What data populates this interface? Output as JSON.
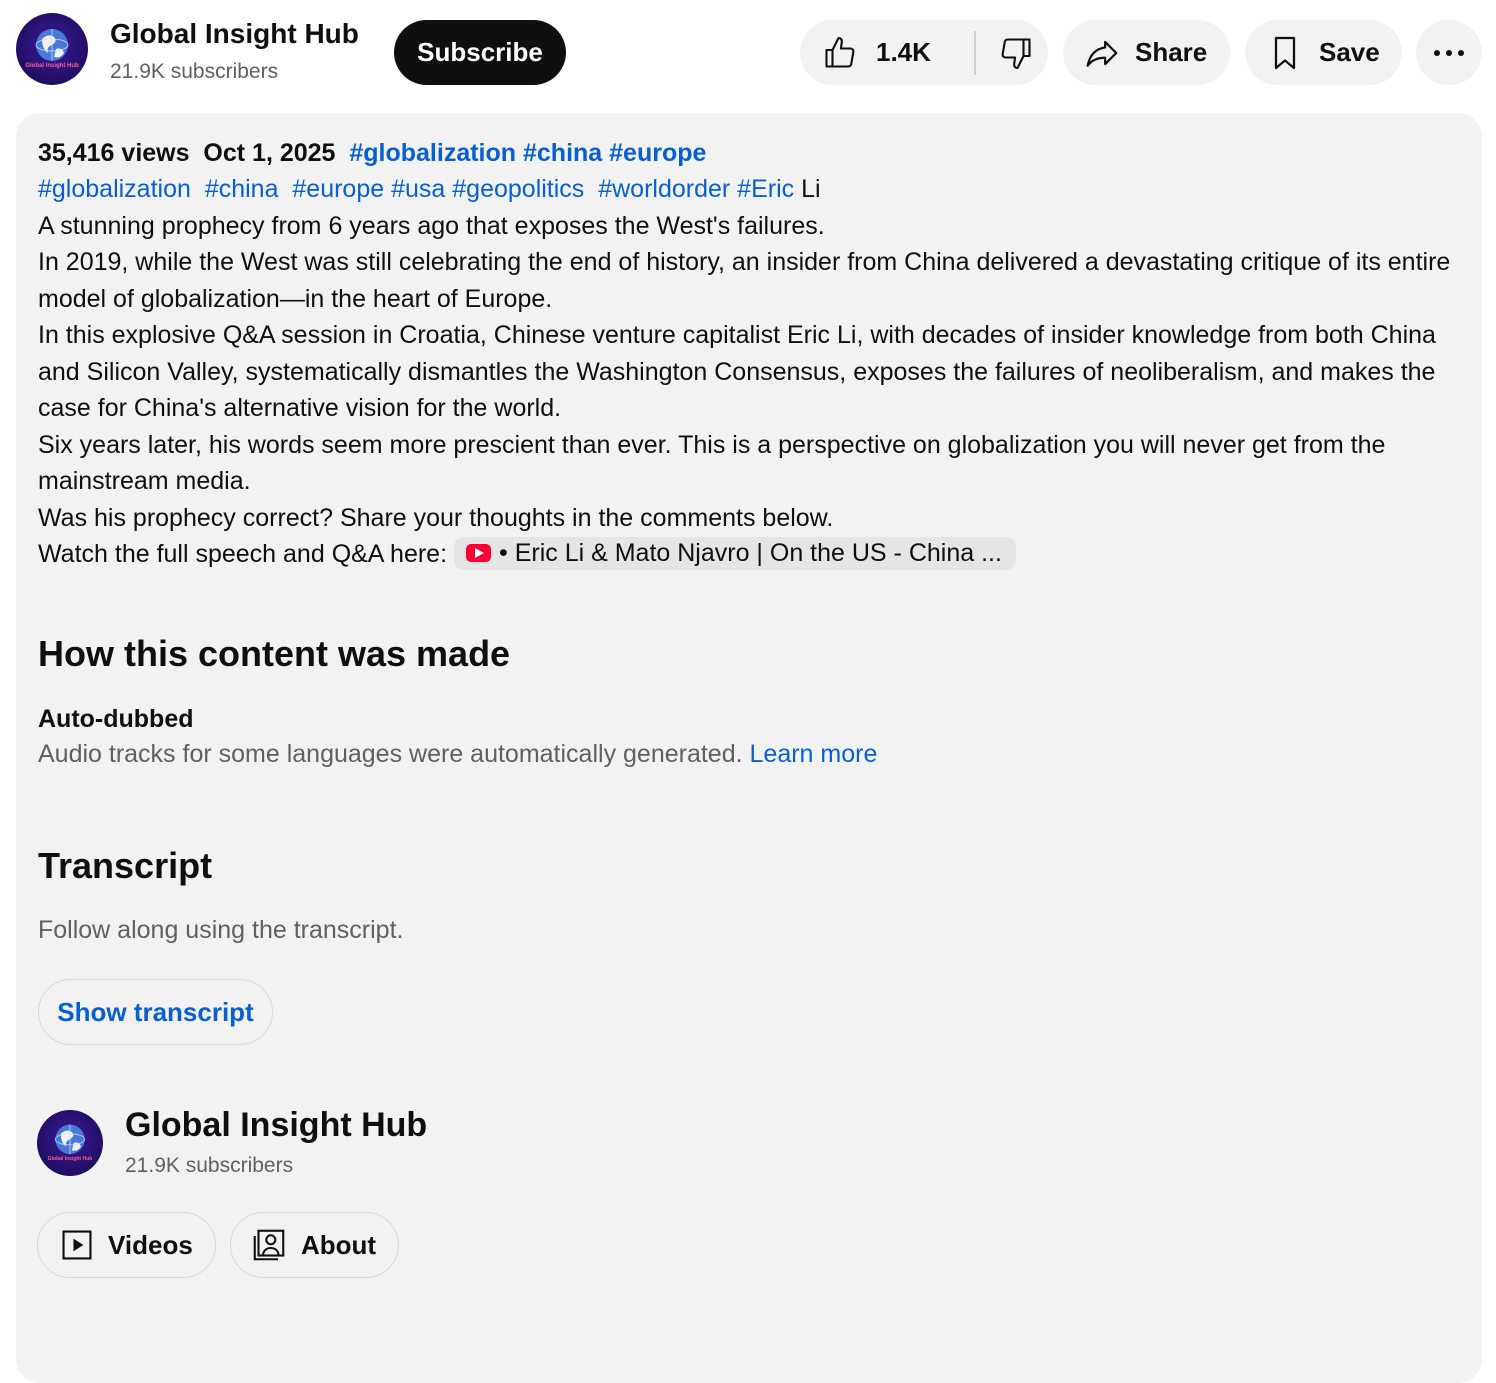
{
  "channel": {
    "name": "Global Insight Hub",
    "subscribers": "21.9K subscribers",
    "logo_text": "Global Insight Hub"
  },
  "actions": {
    "subscribe_label": "Subscribe",
    "like_count": "1.4K",
    "share_label": "Share",
    "save_label": "Save"
  },
  "description": {
    "views": "35,416 views",
    "date": "Oct 1, 2025",
    "header_tags": [
      "#globalization",
      "#china",
      "#europe"
    ],
    "hashtags": [
      "#globalization",
      "#china",
      "#europe",
      "#usa",
      "#geopolitics",
      "#worldorder",
      "#Eric"
    ],
    "hashtag_suffix": "Li",
    "paragraphs": [
      "A stunning prophecy from 6 years ago that exposes the West's failures.",
      "In 2019, while the West was still celebrating the end of history, an insider from China delivered a devastating critique of its entire model of globalization—in the heart of Europe.",
      "In this explosive Q&A session in Croatia, Chinese venture capitalist Eric Li, with decades of insider knowledge from both China and Silicon Valley, systematically dismantles the Washington Consensus, exposes the failures of neoliberalism, and makes the case for China's alternative vision for the world.",
      "Six years later, his words seem more prescient than ever. This is a perspective on globalization you will never get from the mainstream media.",
      "Was his prophecy correct? Share your thoughts in the comments below."
    ],
    "watch_prefix": "Watch the full speech and Q&A here:",
    "watch_link": "• Eric Li & Mato Njavro | On the US - China ..."
  },
  "content_made": {
    "title": "How this content was made",
    "label": "Auto-dubbed",
    "text": "Audio tracks for some languages were automatically generated.",
    "learn_more": "Learn more"
  },
  "transcript": {
    "title": "Transcript",
    "text": "Follow along using the transcript.",
    "button_label": "Show transcript"
  },
  "channel_buttons": {
    "videos_label": "Videos",
    "about_label": "About"
  },
  "colors": {
    "link": "#065fd4",
    "card_bg": "#f2f2f2",
    "subscribe_bg": "#0f0f0f",
    "youtube_red": "#ff0033"
  }
}
